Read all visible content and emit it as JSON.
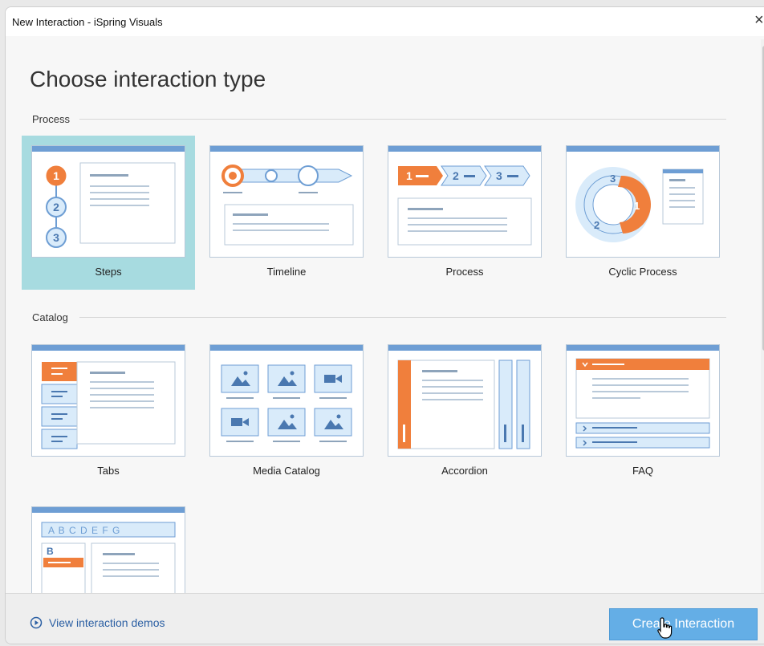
{
  "window": {
    "title": "New Interaction - iSpring Visuals",
    "close_glyph": "×"
  },
  "heading": "Choose interaction type",
  "sections": {
    "process": {
      "label": "Process",
      "items": [
        {
          "label": "Steps",
          "selected": true
        },
        {
          "label": "Timeline",
          "selected": false
        },
        {
          "label": "Process",
          "selected": false
        },
        {
          "label": "Cyclic Process",
          "selected": false
        }
      ]
    },
    "catalog": {
      "label": "Catalog",
      "items": [
        {
          "label": "Tabs"
        },
        {
          "label": "Media Catalog"
        },
        {
          "label": "Accordion"
        },
        {
          "label": "FAQ"
        }
      ]
    },
    "glossary_letters": "A B C D E F G",
    "glossary_entry": "B"
  },
  "thumb_text": {
    "steps": [
      "1",
      "2",
      "3"
    ],
    "process": [
      "1",
      "2",
      "3"
    ],
    "cyclic": [
      "3",
      "1",
      "2"
    ]
  },
  "footer": {
    "demo_link": "View interaction demos",
    "create_button": "Create Interaction"
  },
  "colors": {
    "accent": "#f07f3c",
    "blue": "#6e9ed4",
    "selected": "#a7dbe0",
    "button": "#64aee6"
  }
}
